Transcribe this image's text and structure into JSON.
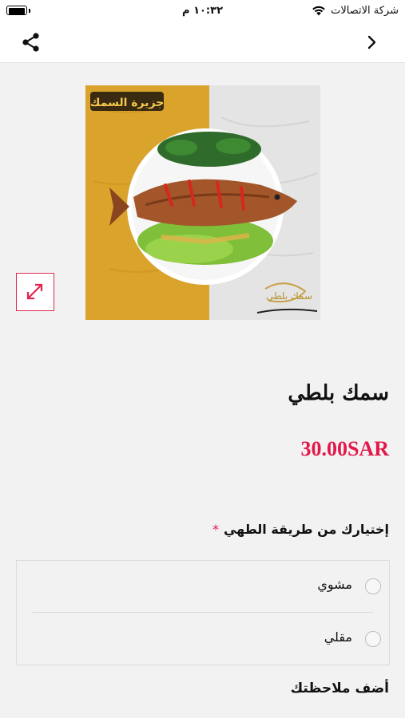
{
  "status_bar": {
    "carrier": "شركة الاتصالات",
    "time": "١٠:٣٢ م"
  },
  "nav": {
    "share_icon": "share-icon",
    "back_icon": "chevron-right-icon"
  },
  "product": {
    "image_banner": "جزيرة السمك",
    "image_caption": "سمك بلطي",
    "name": "سمك بلطي",
    "price": "30.00SAR"
  },
  "cooking_options": {
    "label": "إختيارك من طريقة الطهي",
    "required_mark": "*",
    "items": [
      {
        "label": "مشوي",
        "selected": false
      },
      {
        "label": "مقلي",
        "selected": false
      }
    ]
  },
  "notes": {
    "label": "أضف ملاحظتك"
  },
  "colors": {
    "accent": "#e3184a",
    "image_left": "#d9a32c",
    "image_right": "#e4e4e4"
  }
}
